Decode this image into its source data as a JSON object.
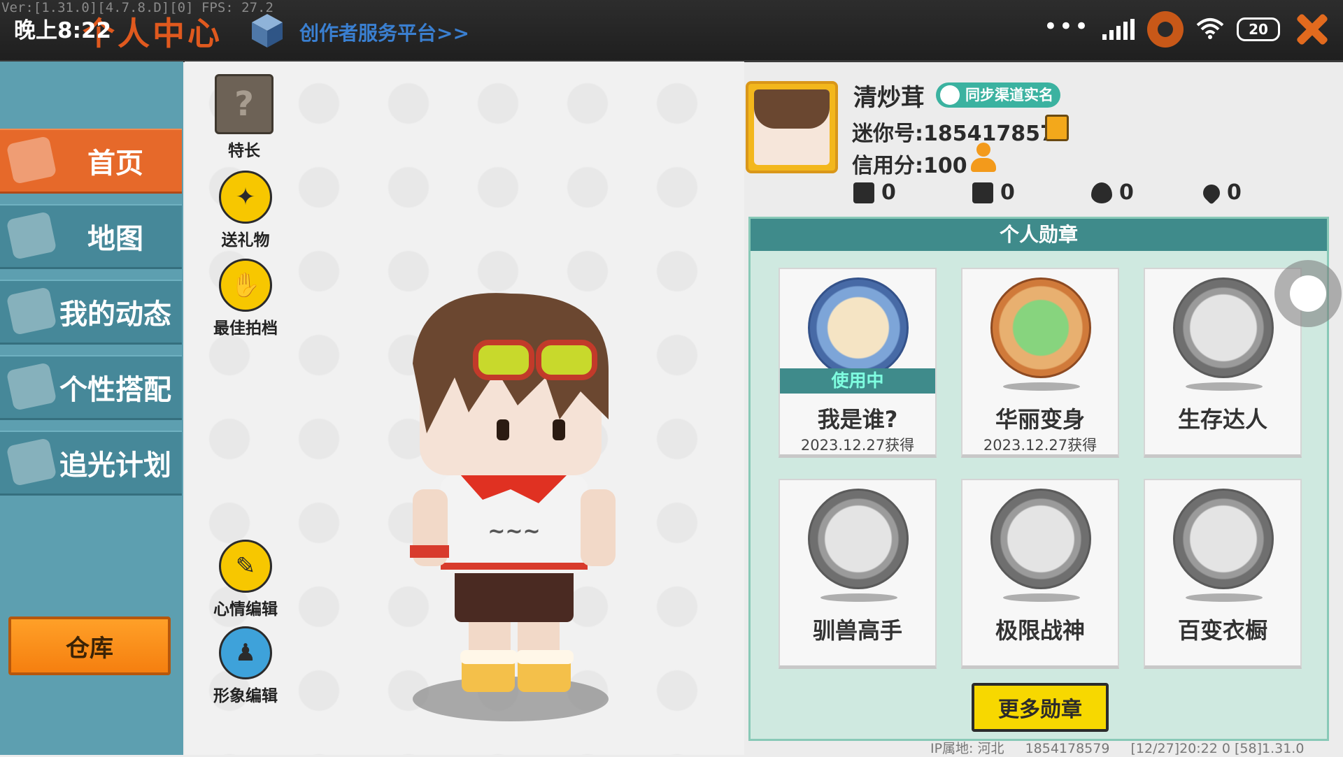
{
  "status_bar": {
    "version_text": "Ver:[1.31.0][4.7.8.D][0] FPS: 27.2",
    "time": "晚上8:22",
    "battery": "20"
  },
  "header": {
    "title": "个人中心",
    "creator_link": "创作者服务平台>>"
  },
  "sidebar": {
    "items": [
      {
        "label": "首页",
        "active": true,
        "icon": "home-icon"
      },
      {
        "label": "地图",
        "active": false,
        "icon": "map-icon"
      },
      {
        "label": "我的动态",
        "active": false,
        "icon": "bell-icon"
      },
      {
        "label": "个性搭配",
        "active": false,
        "icon": "outfit-icon"
      },
      {
        "label": "追光计划",
        "active": false,
        "icon": "camera-icon"
      }
    ],
    "warehouse": "仓库"
  },
  "tools": {
    "specialty": "特长",
    "gift": "送礼物",
    "partner": "最佳拍档",
    "mood": "心情编辑",
    "appearance": "形象编辑"
  },
  "profile": {
    "nickname": "清炒茸",
    "realname_badge": "同步渠道实名",
    "mini_id": "迷你号:1854178579",
    "credit": "信用分:100",
    "stats": {
      "plus": "0",
      "trophy": "0",
      "fire": "0",
      "heart": "0"
    }
  },
  "medals": {
    "header": "个人勋章",
    "in_use_label": "使用中",
    "items": [
      {
        "name": "我是谁?",
        "date": "2023.12.27获得",
        "in_use": true
      },
      {
        "name": "华丽变身",
        "date": "2023.12.27获得",
        "in_use": false
      },
      {
        "name": "生存达人",
        "date": "",
        "in_use": false
      },
      {
        "name": "驯兽高手",
        "date": "",
        "in_use": false
      },
      {
        "name": "极限战神",
        "date": "",
        "in_use": false
      },
      {
        "name": "百变衣橱",
        "date": "",
        "in_use": false
      }
    ],
    "more_button": "更多勋章"
  },
  "footer": {
    "ip": "IP属地: 河北",
    "uid": "1854178579",
    "stamp": "[12/27]20:22 0  [58]1.31.0"
  },
  "colors": {
    "accent_orange": "#e6692a",
    "sidebar_teal": "#468899",
    "medal_header": "#3f8b8b",
    "button_yellow": "#f7d800"
  }
}
